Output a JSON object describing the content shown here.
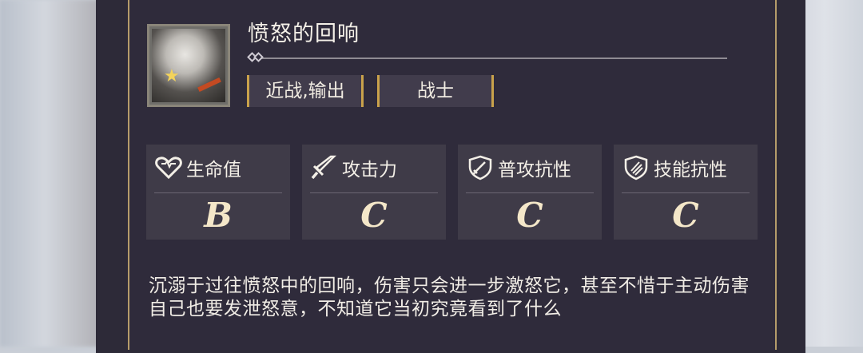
{
  "card": {
    "name": "愤怒的回响",
    "tags": [
      "近战,输出",
      "战士"
    ],
    "stats": [
      {
        "label": "生命值",
        "grade": "B",
        "icon": "heart-icon"
      },
      {
        "label": "攻击力",
        "grade": "C",
        "icon": "sword-icon"
      },
      {
        "label": "普攻抗性",
        "grade": "C",
        "icon": "shield-sword-icon"
      },
      {
        "label": "技能抗性",
        "grade": "C",
        "icon": "shield-claw-icon"
      }
    ],
    "description": "沉溺于过往愤怒中的回响，伤害只会进一步激怒它，甚至不惜于主动伤害自己也要发泄怒意，不知道它当初究竟看到了什么"
  },
  "colors": {
    "panel": "#2f2b3b",
    "tag_border": "#c9a24b",
    "stat_bg": "#3f3b48",
    "grade": "#f4e7c9"
  }
}
